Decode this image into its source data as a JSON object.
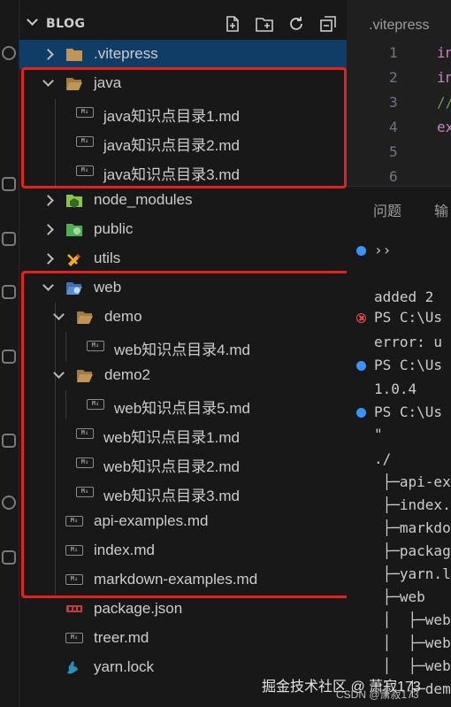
{
  "explorer": {
    "title": "BLOG",
    "items": [
      {
        "label": ".vitepress",
        "kind": "folder",
        "state": "closed",
        "icon": "folder-icon"
      },
      {
        "label": "java",
        "kind": "folder",
        "state": "open",
        "icon": "folder-open-icon"
      },
      {
        "label": "java知识点目录1.md",
        "kind": "file",
        "icon": "markdown-icon"
      },
      {
        "label": "java知识点目录2.md",
        "kind": "file",
        "icon": "markdown-icon"
      },
      {
        "label": "java知识点目录3.md",
        "kind": "file",
        "icon": "markdown-icon"
      },
      {
        "label": "node_modules",
        "kind": "folder",
        "state": "closed",
        "icon": "node-folder-icon"
      },
      {
        "label": "public",
        "kind": "folder",
        "state": "closed",
        "icon": "public-folder-icon"
      },
      {
        "label": "utils",
        "kind": "folder",
        "state": "closed",
        "icon": "utils-folder-icon"
      },
      {
        "label": "web",
        "kind": "folder",
        "state": "open",
        "icon": "web-folder-icon"
      },
      {
        "label": "demo",
        "kind": "folder",
        "state": "open",
        "icon": "folder-open-icon"
      },
      {
        "label": "web知识点目录4.md",
        "kind": "file",
        "icon": "markdown-icon"
      },
      {
        "label": "demo2",
        "kind": "folder",
        "state": "open",
        "icon": "folder-open-icon"
      },
      {
        "label": "web知识点目录5.md",
        "kind": "file",
        "icon": "markdown-icon"
      },
      {
        "label": "web知识点目录1.md",
        "kind": "file",
        "icon": "markdown-icon"
      },
      {
        "label": "web知识点目录2.md",
        "kind": "file",
        "icon": "markdown-icon"
      },
      {
        "label": "web知识点目录3.md",
        "kind": "file",
        "icon": "markdown-icon"
      },
      {
        "label": "api-examples.md",
        "kind": "file",
        "icon": "markdown-icon"
      },
      {
        "label": "index.md",
        "kind": "file",
        "icon": "markdown-icon"
      },
      {
        "label": "markdown-examples.md",
        "kind": "file",
        "icon": "markdown-icon"
      },
      {
        "label": "package.json",
        "kind": "file",
        "icon": "npm-icon"
      },
      {
        "label": "treer.md",
        "kind": "file",
        "icon": "markdown-icon"
      },
      {
        "label": "yarn.lock",
        "kind": "file",
        "icon": "yarn-icon"
      }
    ]
  },
  "editor": {
    "tab": ".vitepress",
    "line_numbers": [
      "1",
      "2",
      "3",
      "4",
      "5",
      "6"
    ],
    "code": [
      "in",
      "in",
      "//",
      "ex"
    ]
  },
  "panel": {
    "tabs": [
      "问题",
      "输"
    ],
    "lines": [
      "››",
      "added 2",
      "PS C:\\Us",
      "error: u",
      "PS C:\\Us",
      "1.0.4",
      "PS C:\\Us",
      "\"",
      "./",
      " ├─api-ex",
      " ├─index.",
      " ├─markdo",
      " ├─packag",
      " ├─yarn.l",
      " ├─web",
      " │  ├─web",
      " │  ├─web",
      " │  ├─web",
      " │  ├─dem"
    ]
  },
  "watermark": {
    "text": "掘金技术社区 @ 萧寂173",
    "text2": "CSDN @萧寂173"
  },
  "colors": {
    "highlight_box": "#e5211d",
    "selected_row": "#0f3d66",
    "terminal_info": "#3794ff",
    "terminal_error": "#f14c4c"
  }
}
